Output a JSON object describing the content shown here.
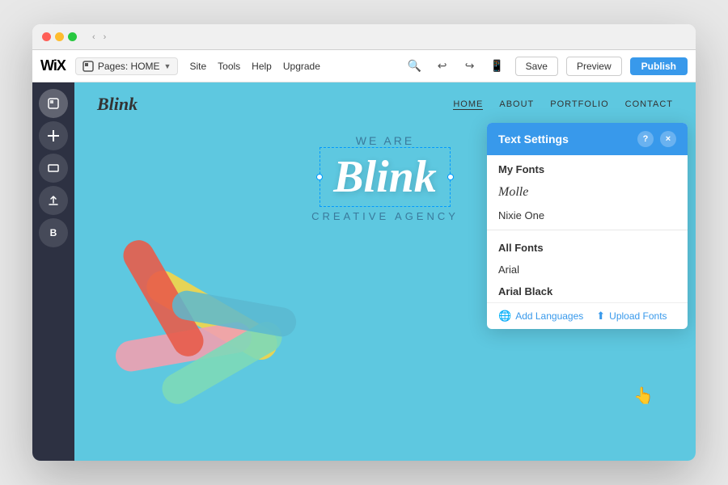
{
  "browser": {
    "nav_back": "‹",
    "nav_forward": "›"
  },
  "wix": {
    "logo": "WiX",
    "pages_label": "Pages: HOME",
    "menu": {
      "site": "Site",
      "tools": "Tools",
      "help": "Help",
      "upgrade": "Upgrade"
    },
    "buttons": {
      "save": "Save",
      "preview": "Preview",
      "publish": "Publish"
    }
  },
  "sidebar": {
    "buttons": [
      "⊞",
      "+",
      "▬",
      "↑",
      "B"
    ]
  },
  "site": {
    "logo": "Blink",
    "nav": [
      "HOME",
      "ABOUT",
      "PORTFOLIO",
      "CONTACT"
    ],
    "hero": {
      "we_are": "WE ARE",
      "title": "Blink",
      "subtitle": "CREATIVE AGENCY"
    }
  },
  "text_settings_panel": {
    "title": "Text Settings",
    "help_label": "?",
    "close_label": "×",
    "my_fonts_header": "My Fonts",
    "fonts_list_my": [
      {
        "name": "Molle",
        "style": "italic"
      },
      {
        "name": "Nixie One",
        "style": "normal"
      }
    ],
    "all_fonts_header": "All Fonts",
    "fonts_list_all": [
      {
        "name": "Arial",
        "style": "normal"
      },
      {
        "name": "Arial Black",
        "style": "bold"
      }
    ],
    "footer": {
      "add_languages": "Add Languages",
      "upload_fonts": "Upload Fonts"
    }
  }
}
